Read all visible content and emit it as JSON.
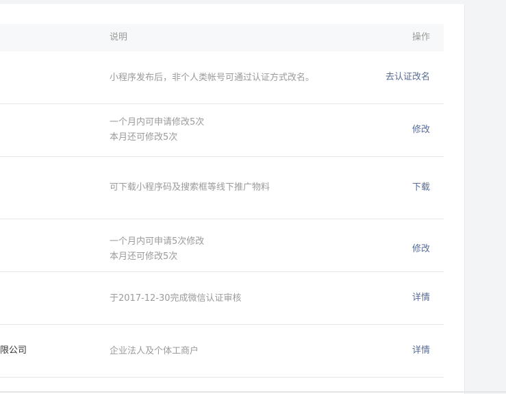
{
  "table": {
    "headers": {
      "description": "说明",
      "action": "操作"
    },
    "rows": [
      {
        "name": "",
        "description": [
          "小程序发布后，非个人类帐号可通过认证方式改名。"
        ],
        "action": "去认证改名"
      },
      {
        "name": "",
        "description": [
          "一个月内可申请修改5次",
          "本月还可修改5次"
        ],
        "action": "修改"
      },
      {
        "name": "",
        "description": [
          "可下载小程序码及搜索框等线下推广物料"
        ],
        "action": "下载"
      },
      {
        "name": "",
        "description": [
          "一个月内可申请5次修改",
          "本月还可修改5次"
        ],
        "action": "修改"
      },
      {
        "name": "",
        "description": [
          "于2017-12-30完成微信认证审核"
        ],
        "action": "详情"
      },
      {
        "name": "限公司",
        "description": [
          "企业法人及个体工商户"
        ],
        "action": "详情"
      }
    ]
  }
}
